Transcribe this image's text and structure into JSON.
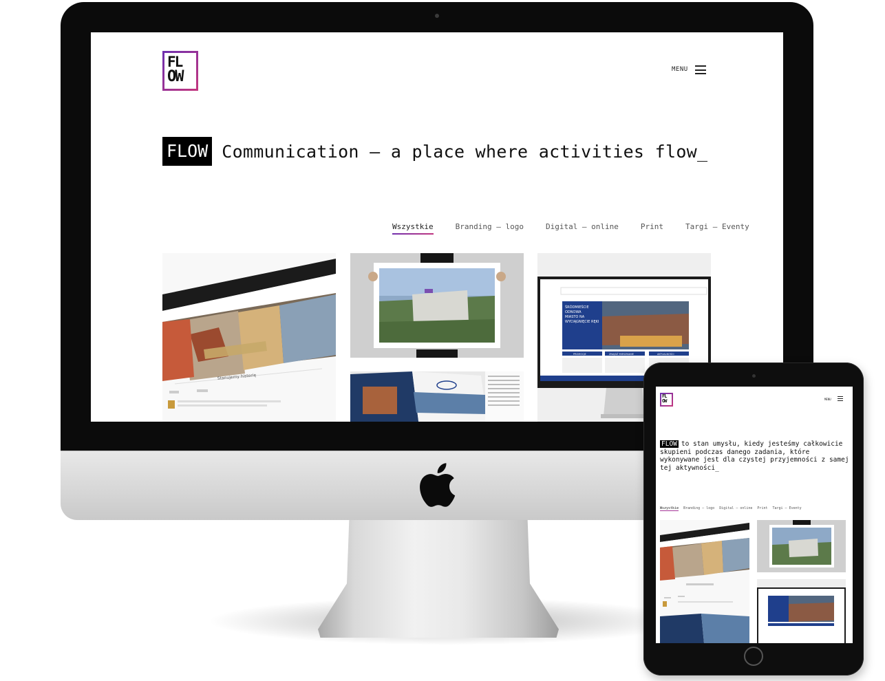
{
  "colors": {
    "accent_start": "#6f2fae",
    "accent_end": "#c2367f",
    "text": "#111111",
    "badge_bg": "#000000",
    "badge_text": "#ffffff"
  },
  "desktop": {
    "logo": {
      "line1": "FL",
      "line2": "OW"
    },
    "menu_label": "MENU",
    "menu_icon": "hamburger-icon",
    "hero": {
      "badge": "FLOW",
      "text": "Communication – a place where activities flow_"
    },
    "filters": [
      "Wszystkie",
      "Branding – logo",
      "Digital – online",
      "Print",
      "Targi – Eventy"
    ],
    "active_filter_index": 0
  },
  "tablet": {
    "logo": {
      "line1": "FL",
      "line2": "OW"
    },
    "menu_label": "MENU",
    "menu_icon": "hamburger-icon",
    "hero": {
      "badge": "FLOW",
      "text": "to stan umysłu, kiedy jesteśmy całkowicie skupieni podczas danego zadania, które wykonywane jest dla czystej przyjemności z samej tej aktywności_"
    },
    "filters": [
      "Wszystkie",
      "Branding – logo",
      "Digital – online",
      "Print",
      "Targi – Eventy"
    ],
    "active_filter_index": 0
  },
  "thumbnails": {
    "t1": {
      "caption": "Stanujemy historię"
    },
    "t3": {
      "panel_line1": "ŚRÓDMIEŚCIE",
      "panel_line2": "ODNOWA",
      "panel_line3": "MIASTO NA",
      "panel_line4": "WYCIĄGNIĘCIE RĘKI",
      "tab1": "PROMOCJE",
      "tab2": "ZNAJDŹ MIESZKANIE",
      "tab3": "AKTUALNOŚCI"
    }
  }
}
